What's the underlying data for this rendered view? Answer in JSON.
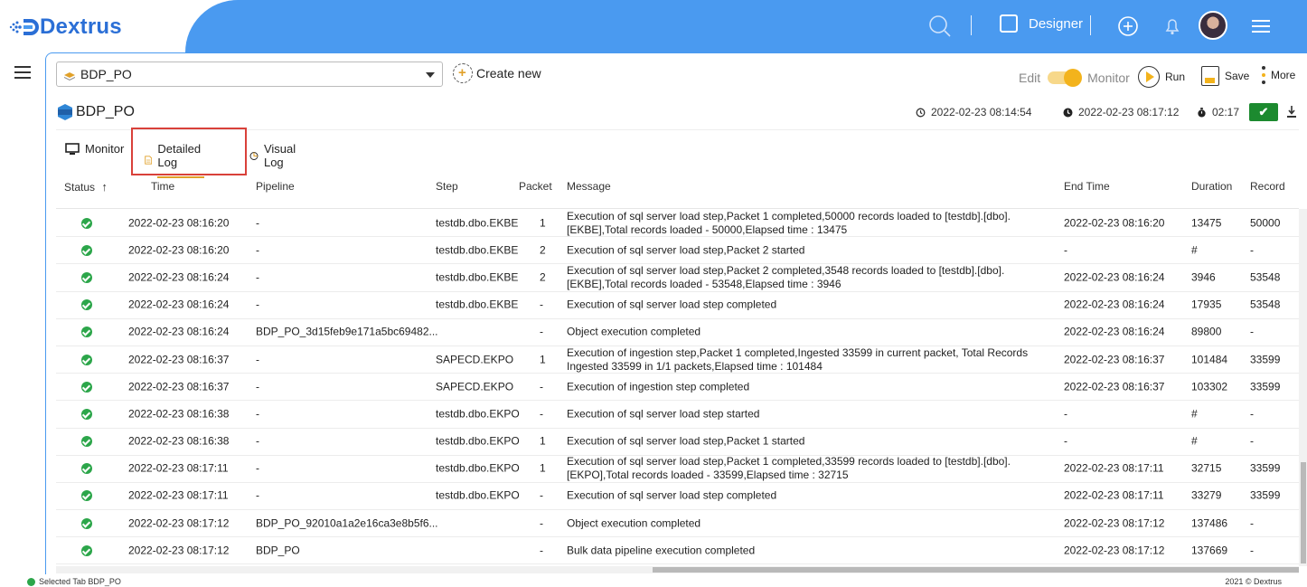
{
  "brand": {
    "name": "Dextrus",
    "color": "#2b6fd6"
  },
  "header": {
    "accent": "#4a9af0",
    "designer_label": "Designer"
  },
  "toolbar": {
    "pipeline_selected": "BDP_PO",
    "create_new": "Create new",
    "edit_label": "Edit",
    "monitor_label": "Monitor",
    "run_label": "Run",
    "save_label": "Save",
    "more_label": "More"
  },
  "object": {
    "title": "BDP_PO",
    "start_time": "2022-02-23 08:14:54",
    "end_time": "2022-02-23 08:17:12",
    "elapsed": "02:17",
    "status_check": "✔"
  },
  "tabs": [
    {
      "label": "Monitor"
    },
    {
      "label": "Detailed Log"
    },
    {
      "label": "Visual Log"
    }
  ],
  "columns": {
    "status": "Status",
    "time": "Time",
    "pipeline": "Pipeline",
    "step": "Step",
    "packet": "Packet",
    "message": "Message",
    "end_time": "End Time",
    "duration": "Duration",
    "record": "Record",
    "sort_indicator": "↑"
  },
  "rows": [
    {
      "time": "2022-02-23 08:16:20",
      "pipeline": "-",
      "step": "testdb.dbo.EKBE",
      "packet": "1",
      "message": "Execution of sql server load step,Packet 1 completed,50000 records loaded to [testdb].[dbo].[EKBE],Total records loaded - 50000,Elapsed time : 13475",
      "end_time": "2022-02-23 08:16:20",
      "duration": "13475",
      "record": "50000"
    },
    {
      "time": "2022-02-23 08:16:20",
      "pipeline": "-",
      "step": "testdb.dbo.EKBE",
      "packet": "2",
      "message": "Execution of sql server load step,Packet 2 started",
      "end_time": "-",
      "duration": "#",
      "record": "-"
    },
    {
      "time": "2022-02-23 08:16:24",
      "pipeline": "-",
      "step": "testdb.dbo.EKBE",
      "packet": "2",
      "message": "Execution of sql server load step,Packet 2 completed,3548 records loaded to [testdb].[dbo].[EKBE],Total records loaded - 53548,Elapsed time : 3946",
      "end_time": "2022-02-23 08:16:24",
      "duration": "3946",
      "record": "53548"
    },
    {
      "time": "2022-02-23 08:16:24",
      "pipeline": "-",
      "step": "testdb.dbo.EKBE",
      "packet": "-",
      "message": "Execution of sql server load step completed",
      "end_time": "2022-02-23 08:16:24",
      "duration": "17935",
      "record": "53548"
    },
    {
      "time": "2022-02-23 08:16:24",
      "pipeline": "BDP_PO_3d15feb9e171a5bc69482...",
      "step": "",
      "packet": "-",
      "message": "Object execution completed",
      "end_time": "2022-02-23 08:16:24",
      "duration": "89800",
      "record": "-"
    },
    {
      "time": "2022-02-23 08:16:37",
      "pipeline": "-",
      "step": "SAPECD.EKPO",
      "packet": "1",
      "message": "Execution of ingestion step,Packet 1 completed,Ingested 33599 in current packet, Total Records Ingested 33599 in 1/1 packets,Elapsed time : 101484",
      "end_time": "2022-02-23 08:16:37",
      "duration": "101484",
      "record": "33599"
    },
    {
      "time": "2022-02-23 08:16:37",
      "pipeline": "-",
      "step": "SAPECD.EKPO",
      "packet": "-",
      "message": "Execution of ingestion step completed",
      "end_time": "2022-02-23 08:16:37",
      "duration": "103302",
      "record": "33599"
    },
    {
      "time": "2022-02-23 08:16:38",
      "pipeline": "-",
      "step": "testdb.dbo.EKPO",
      "packet": "-",
      "message": "Execution of sql server load step started",
      "end_time": "-",
      "duration": "#",
      "record": "-"
    },
    {
      "time": "2022-02-23 08:16:38",
      "pipeline": "-",
      "step": "testdb.dbo.EKPO",
      "packet": "1",
      "message": "Execution of sql server load step,Packet 1 started",
      "end_time": "-",
      "duration": "#",
      "record": "-"
    },
    {
      "time": "2022-02-23 08:17:11",
      "pipeline": "-",
      "step": "testdb.dbo.EKPO",
      "packet": "1",
      "message": "Execution of sql server load step,Packet 1 completed,33599 records loaded to [testdb].[dbo].[EKPO],Total records loaded - 33599,Elapsed time : 32715",
      "end_time": "2022-02-23 08:17:11",
      "duration": "32715",
      "record": "33599"
    },
    {
      "time": "2022-02-23 08:17:11",
      "pipeline": "-",
      "step": "testdb.dbo.EKPO",
      "packet": "-",
      "message": "Execution of sql server load step completed",
      "end_time": "2022-02-23 08:17:11",
      "duration": "33279",
      "record": "33599"
    },
    {
      "time": "2022-02-23 08:17:12",
      "pipeline": "BDP_PO_92010a1a2e16ca3e8b5f6...",
      "step": "",
      "packet": "-",
      "message": "Object execution completed",
      "end_time": "2022-02-23 08:17:12",
      "duration": "137486",
      "record": "-"
    },
    {
      "time": "2022-02-23 08:17:12",
      "pipeline": "BDP_PO",
      "step": "",
      "packet": "-",
      "message": "Bulk data pipeline execution completed",
      "end_time": "2022-02-23 08:17:12",
      "duration": "137669",
      "record": "-"
    }
  ],
  "footer": {
    "selected_tab": "Selected Tab BDP_PO",
    "copyright": "2021 © Dextrus"
  }
}
